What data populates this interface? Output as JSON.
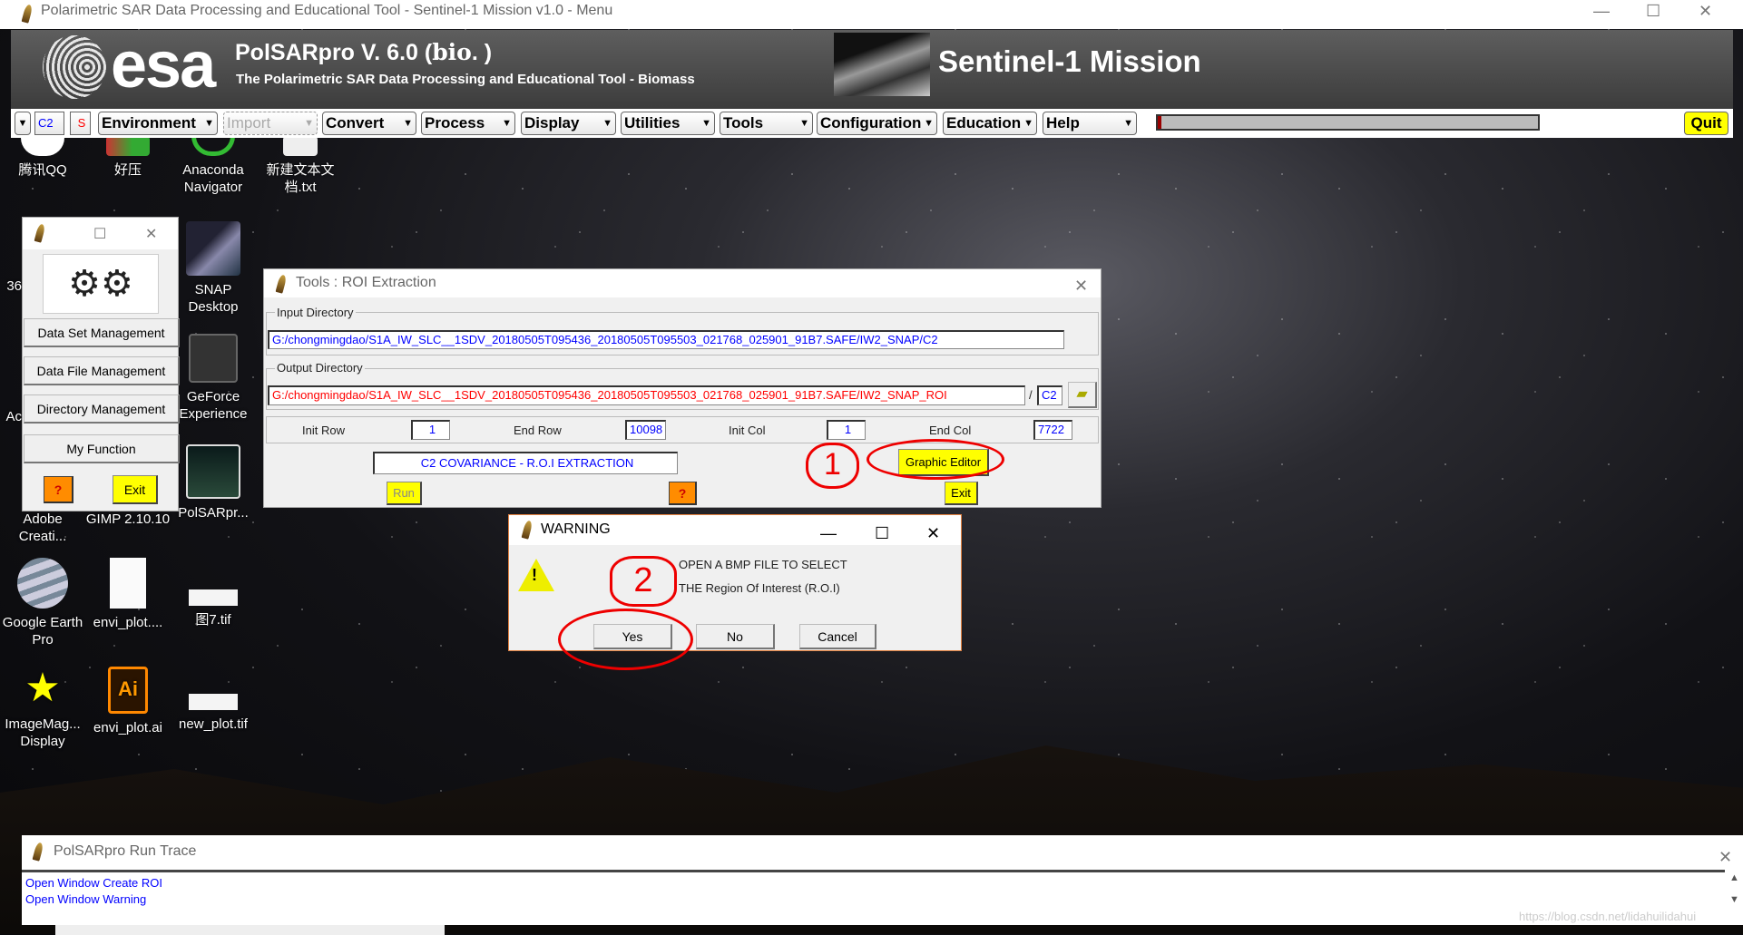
{
  "main_window": {
    "title": "Polarimetric SAR Data Processing and Educational Tool - Sentinel-1 Mission v1.0 - Menu",
    "banner": {
      "logo": "esa",
      "product": "PolSARpro V. 6.0 (",
      "product_suffix": "bio",
      ") ": "",
      "product_close": ". )",
      "subtitle": "The Polarimetric SAR Data Processing and Educational Tool - Biomass",
      "mission": "Sentinel-1 Mission"
    },
    "toolbar": {
      "mode_value": "C2",
      "s_label": "S",
      "menus": [
        "Environment",
        "Import",
        "Convert",
        "Process",
        "Display",
        "Utilities",
        "Tools",
        "Configuration",
        "Education",
        "Help"
      ],
      "progress": 0.01,
      "quit": "Quit"
    }
  },
  "desktop": {
    "icons": [
      "腾讯QQ",
      "好压",
      "Anaconda Navigator",
      "新建文本文档.txt",
      "SNAP Desktop",
      "GeForce Experience",
      "PolSARpr...",
      "36",
      "Ac",
      "Adobe Creati...",
      "GIMP 2.10.10",
      "Google Earth Pro",
      "envi_plot....",
      "图7.tif",
      "ImageMag... Display",
      "envi_plot.ai",
      "new_plot.tif"
    ]
  },
  "side_menu": {
    "items": [
      "Data Set Management",
      "Data File Management",
      "Directory Management",
      "My Function"
    ],
    "help": "?",
    "exit": "Exit"
  },
  "roi_window": {
    "title": "Tools : ROI Extraction",
    "input_label": "Input Directory",
    "input_value": "G:/chongmingdao/S1A_IW_SLC__1SDV_20180505T095436_20180505T095503_021768_025901_91B7.SAFE/IW2_SNAP/C2",
    "output_label": "Output Directory",
    "output_value": "G:/chongmingdao/S1A_IW_SLC__1SDV_20180505T095436_20180505T095503_021768_025901_91B7.SAFE/IW2_SNAP_ROI",
    "slash": "/",
    "output_sub": "C2",
    "init_row_label": "Init Row",
    "init_row": "1",
    "end_row_label": "End Row",
    "end_row": "10098",
    "init_col_label": "Init Col",
    "init_col": "1",
    "end_col_label": "End Col",
    "end_col": "7722",
    "mode": "C2 COVARIANCE - R.O.I EXTRACTION",
    "graphic_editor": "Graphic Editor",
    "run": "Run",
    "help": "?",
    "exit": "Exit"
  },
  "warning": {
    "title": "WARNING",
    "line1": "OPEN A BMP FILE TO SELECT",
    "line2": "THE Region Of Interest (R.O.I)",
    "yes": "Yes",
    "no": "No",
    "cancel": "Cancel"
  },
  "annotations": {
    "step1": "1",
    "step2": "2",
    "color": "#e00000"
  },
  "run_trace": {
    "title": "PolSARpro Run Trace",
    "lines": [
      "Open Window Create ROI",
      "Open Window Warning"
    ]
  },
  "watermark": "https://blog.csdn.net/lidahuilidahui"
}
